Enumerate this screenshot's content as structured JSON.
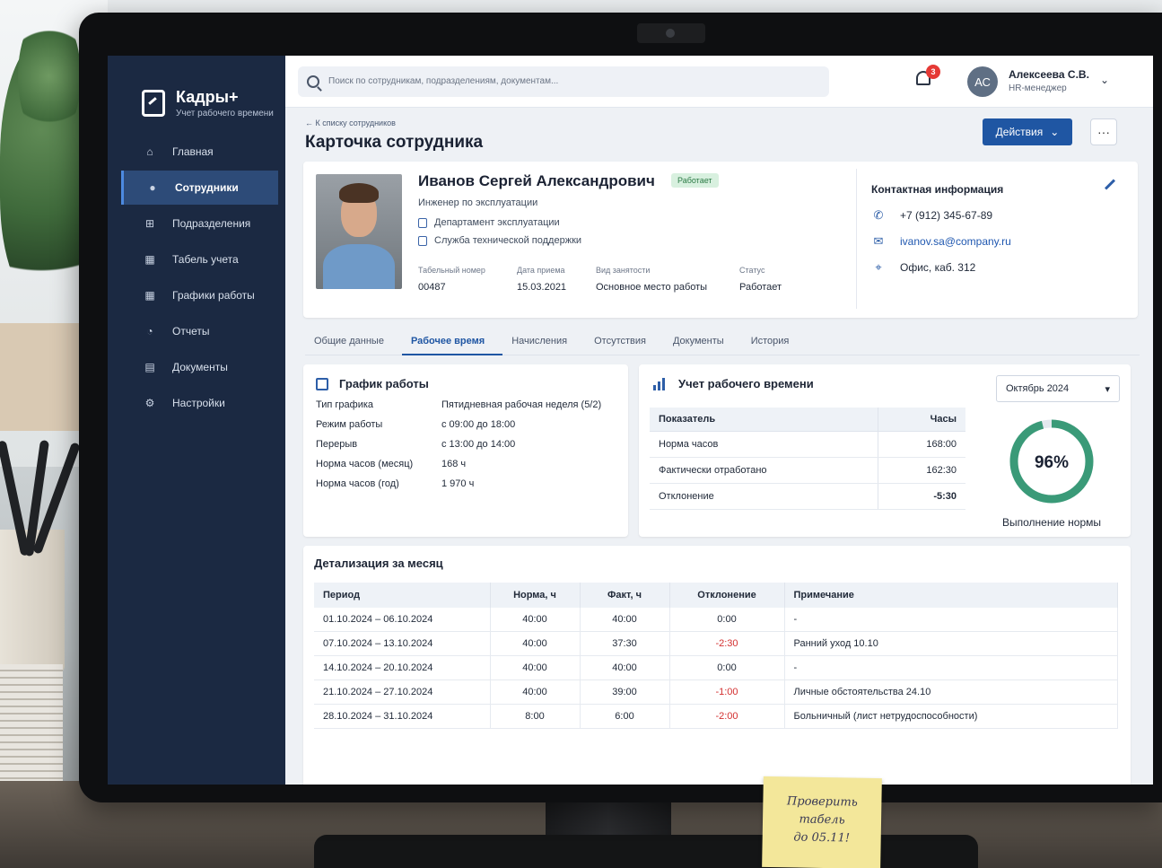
{
  "app": {
    "name": "Кадры+",
    "subtitle": "Учет рабочего времени"
  },
  "sidebar": {
    "items": [
      {
        "label": "Главная",
        "icon": "home-icon"
      },
      {
        "label": "Сотрудники",
        "icon": "users-icon",
        "active": true
      },
      {
        "label": "Подразделения",
        "icon": "org-icon"
      },
      {
        "label": "Табель учета",
        "icon": "calendar-icon"
      },
      {
        "label": "Графики работы",
        "icon": "calendar-icon"
      },
      {
        "label": "Отчеты",
        "icon": "report-icon"
      },
      {
        "label": "Документы",
        "icon": "document-icon"
      },
      {
        "label": "Настройки",
        "icon": "gear-icon"
      }
    ]
  },
  "topbar": {
    "search_placeholder": "Поиск по сотрудникам, подразделениям, документам...",
    "notifications_count": "3",
    "user_initials": "АС",
    "user_name": "Алексеева С.В.",
    "user_role": "HR-менеджер"
  },
  "page": {
    "back_link": "← К списку сотрудников",
    "title": "Карточка сотрудника",
    "actions_label": "Действия",
    "more_label": "···"
  },
  "employee": {
    "name": "Иванов Сергей Александрович",
    "status_badge": "Работает",
    "position": "Инженер по эксплуатации",
    "department": "Департамент эксплуатации",
    "service": "Служба технической поддержки",
    "fields": [
      {
        "label": "Табельный номер",
        "value": "00487"
      },
      {
        "label": "Дата приема",
        "value": "15.03.2021"
      },
      {
        "label": "Вид занятости",
        "value": "Основное место работы"
      },
      {
        "label": "Статус",
        "value": "Работает"
      }
    ]
  },
  "contacts": {
    "title": "Контактная информация",
    "phone": "+7 (912) 345-67-89",
    "email": "ivanov.sa@company.ru",
    "office": "Офис, каб. 312"
  },
  "tabs": [
    "Общие данные",
    "Рабочее время",
    "Начисления",
    "Отсутствия",
    "Документы",
    "История"
  ],
  "schedule": {
    "title": "График работы",
    "rows": [
      {
        "k": "Тип графика",
        "v": "Пятидневная рабочая неделя (5/2)"
      },
      {
        "k": "Режим работы",
        "v": "с 09:00 до 18:00"
      },
      {
        "k": "Перерыв",
        "v": "с 13:00 до 14:00"
      },
      {
        "k": "Норма часов (месяц)",
        "v": "168 ч"
      },
      {
        "k": "Норма часов (год)",
        "v": "1 970 ч"
      }
    ]
  },
  "timecard": {
    "title": "Учет рабочего времени",
    "month": "Октябрь 2024",
    "col_indicator": "Показатель",
    "col_hours": "Часы",
    "rows": [
      {
        "k": "Норма часов",
        "v": "168:00"
      },
      {
        "k": "Фактически отработано",
        "v": "162:30"
      },
      {
        "k": "Отклонение",
        "v": "-5:30"
      }
    ],
    "completion_percent": 96,
    "completion_label": "96%",
    "completion_caption": "Выполнение нормы"
  },
  "detail": {
    "title": "Детализация за месяц",
    "headers": [
      "Период",
      "Норма, ч",
      "Факт, ч",
      "Отклонение",
      "Примечание"
    ],
    "rows": [
      [
        "01.10.2024 – 06.10.2024",
        "40:00",
        "40:00",
        "0:00",
        "-"
      ],
      [
        "07.10.2024 – 13.10.2024",
        "40:00",
        "37:30",
        "-2:30",
        "Ранний уход 10.10"
      ],
      [
        "14.10.2024 – 20.10.2024",
        "40:00",
        "40:00",
        "0:00",
        "-"
      ],
      [
        "21.10.2024 – 27.10.2024",
        "40:00",
        "39:00",
        "-1:00",
        "Личные обстоятельства 24.10"
      ],
      [
        "28.10.2024 – 31.10.2024",
        "8:00",
        "6:00",
        "-2:00",
        "Больничный (лист нетрудоспособности)"
      ]
    ]
  },
  "sticky_note": {
    "line1": "Проверить",
    "line2": "табель",
    "line3": "до 05.11!"
  },
  "colors": {
    "sidebar": "#1b2942",
    "accent": "#1f56a3",
    "ring": "#3a9a78",
    "negative": "#d32f2f"
  }
}
